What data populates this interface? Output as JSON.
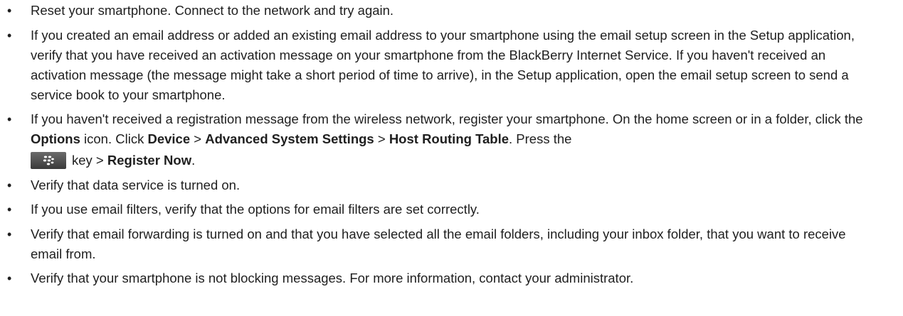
{
  "items": [
    {
      "text": "Reset your smartphone. Connect to the network and try again."
    },
    {
      "text": "If you created an email address or added an existing email address to your smartphone using the email setup screen in the Setup application, verify that you have received an activation message on your smartphone from the BlackBerry Internet Service. If you haven't received an activation message (the message might take a short period of time to arrive), in the Setup application, open the email setup screen to send a service book to your smartphone."
    },
    {
      "part1": "If you haven't received a registration message from the wireless network, register your smartphone. On the home screen or in a folder, click the ",
      "options": "Options",
      "part2": " icon. Click ",
      "device": "Device",
      "sep1": " > ",
      "advanced": "Advanced System Settings",
      "sep2": " > ",
      "host_routing": "Host Routing Table",
      "part3": ". Press the",
      "key_icon": "blackberry-menu-key-icon",
      "key_text": "key > ",
      "register": "Register Now",
      "end": "."
    },
    {
      "text": "Verify that data service is turned on."
    },
    {
      "text": "If you use email filters, verify that the options for email filters are set correctly."
    },
    {
      "text": "Verify that email forwarding is turned on and that you have selected all the email folders, including your inbox folder, that you want to receive email from."
    },
    {
      "text": "Verify that your smartphone is not blocking messages. For more information, contact your administrator."
    }
  ]
}
